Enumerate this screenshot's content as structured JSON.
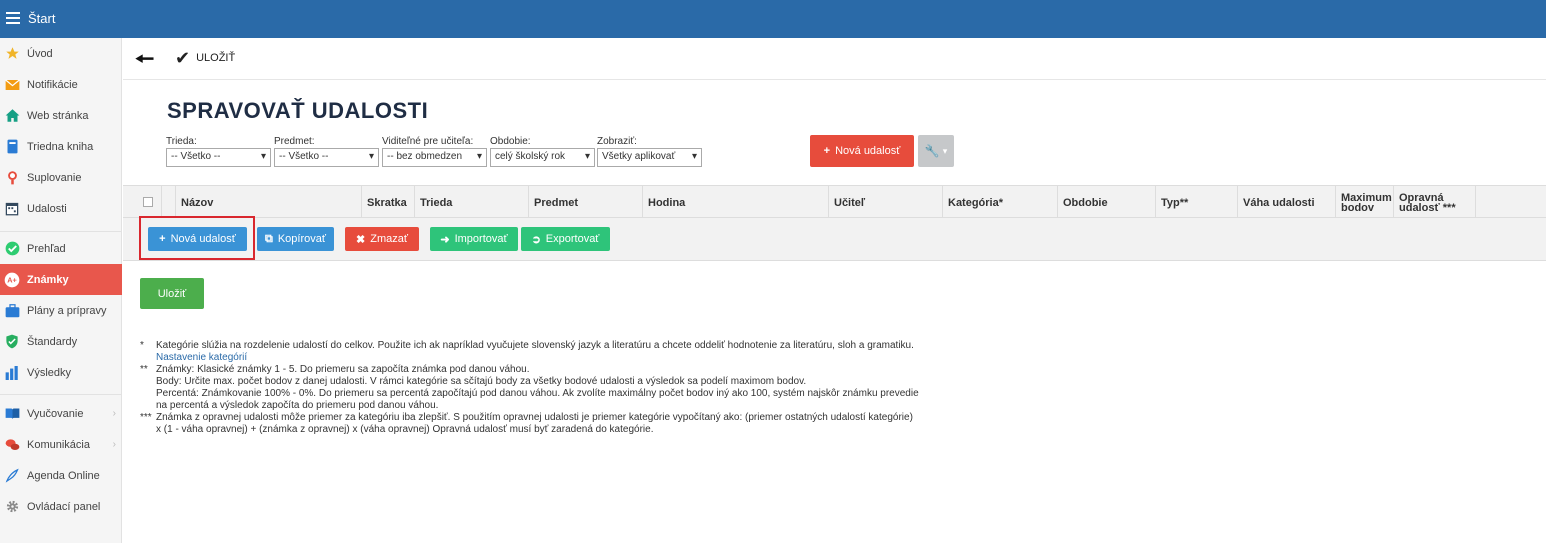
{
  "topbar": {
    "title": "Štart"
  },
  "sidebar": {
    "items": [
      {
        "label": "Úvod",
        "icon": "star-icon"
      },
      {
        "label": "Notifikácie",
        "icon": "envelope-icon"
      },
      {
        "label": "Web stránka",
        "icon": "house-icon"
      },
      {
        "label": "Triedna kniha",
        "icon": "book-icon"
      },
      {
        "label": "Suplovanie",
        "icon": "substitute-icon"
      },
      {
        "label": "Udalosti",
        "icon": "calendar-icon"
      },
      {
        "label": "Prehľad",
        "icon": "check-circle-icon"
      },
      {
        "label": "Známky",
        "icon": "grades-icon",
        "active": true
      },
      {
        "label": "Plány a prípravy",
        "icon": "briefcase-icon"
      },
      {
        "label": "Štandardy",
        "icon": "shield-check-icon"
      },
      {
        "label": "Výsledky",
        "icon": "bar-chart-icon"
      },
      {
        "label": "Vyučovanie",
        "icon": "book-open-icon"
      },
      {
        "label": "Komunikácia",
        "icon": "chat-icon"
      },
      {
        "label": "Agenda Online",
        "icon": "pen-icon"
      },
      {
        "label": "Ovládací panel",
        "icon": "gear-icon"
      }
    ]
  },
  "toolbar": {
    "save_label": "ULOŽIŤ"
  },
  "page": {
    "title": "SPRAVOVAŤ UDALOSTI"
  },
  "filters": [
    {
      "label": "Trieda:",
      "value": "-- Všetko --"
    },
    {
      "label": "Predmet:",
      "value": "-- Všetko --"
    },
    {
      "label": "Viditeľné pre učiteľa:",
      "value": "-- bez obmedzen"
    },
    {
      "label": "Obdobie:",
      "value": "celý školský rok"
    },
    {
      "label": "Zobraziť:",
      "value": "Všetky aplikovať"
    }
  ],
  "new_event_button": "Nová udalosť",
  "table": {
    "columns": [
      "Názov",
      "Skratka",
      "Trieda",
      "Predmet",
      "Hodina",
      "Učiteľ",
      "Kategória*",
      "Obdobie",
      "Typ**",
      "Váha udalosti",
      "Maximum bodov",
      "Opravná udalosť ***"
    ]
  },
  "actions": {
    "new": "Nová udalosť",
    "copy": "Kopírovať",
    "delete": "Zmazať",
    "import": "Importovať",
    "export": "Exportovať"
  },
  "save_button": "Uložiť",
  "notes": [
    {
      "mark": "*",
      "text": "Kategórie slúžia na rozdelenie udalostí do celkov. Použite ich ak napríklad vyučujete slovenský jazyk a literatúru a chcete oddeliť hodnotenie za literatúru, sloh a gramatiku.",
      "link": "Nastavenie kategórií"
    },
    {
      "mark": "**",
      "line1": "Známky: Klasické známky 1 - 5. Do priemeru sa započíta známka pod danou váhou.",
      "line2": "Body: Určite max. počet bodov z danej udalosti. V rámci kategórie sa sčítajú body za všetky bodové udalosti a výsledok sa podelí maximom bodov.",
      "line3": "Percentá: Známkovanie 100% - 0%. Do priemeru sa percentá započítajú pod danou váhou. Ak zvolíte maximálny počet bodov iný ako 100, systém najskôr známku prevedie na percentá a výsledok započíta do priemeru pod danou váhou."
    },
    {
      "mark": "***",
      "text": "Známka z opravnej udalosti môže priemer za kategóriu iba zlepšiť. S použitím opravnej udalosti je priemer kategórie vypočítaný ako: (priemer ostatných udalostí kategórie) x (1 - váha opravnej) + (známka z opravnej) x (váha opravnej) Opravná udalosť musí byť zaradená do kategórie."
    }
  ]
}
